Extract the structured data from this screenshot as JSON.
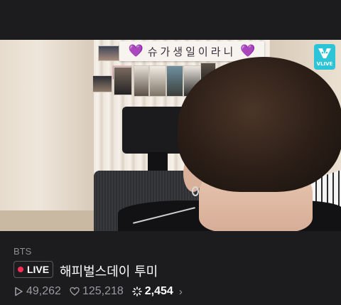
{
  "video": {
    "banner_text": "슈가생일이라니",
    "heart_glyph": "💜",
    "watermark": {
      "icon": "vlive-logo-icon",
      "label": "VLIVE",
      "color": "#2ec4d8"
    }
  },
  "info": {
    "channel": "BTS",
    "live_label": "LIVE",
    "title": "해피벌스데이 투미",
    "stats": {
      "plays": "49,262",
      "likes": "125,218",
      "sparkle": "2,454"
    },
    "icons": {
      "plays": "play-icon",
      "likes": "heart-icon",
      "sparkle": "sparkle-icon",
      "more": "chevron-right-icon"
    },
    "colors": {
      "live_dot": "#ff2d55",
      "muted": "#9a9aa0",
      "background": "#1c1c1e"
    }
  }
}
